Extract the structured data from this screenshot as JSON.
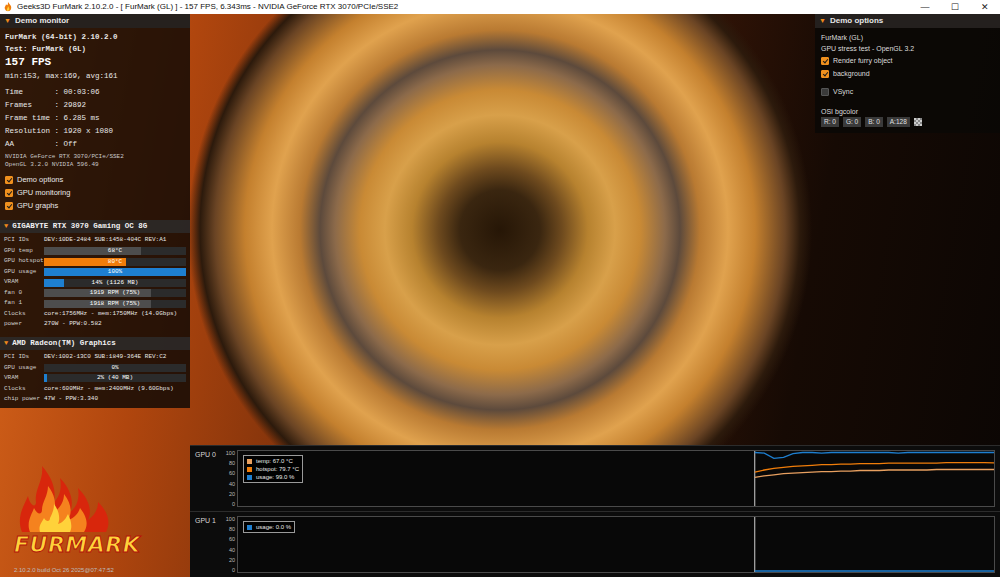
{
  "window": {
    "title": "Geeks3D FurMark 2.10.2.0 - [ FurMark (GL) ] - 157 FPS, 6.343ms - NVIDIA GeForce RTX 3070/PCIe/SSE2",
    "controls": [
      "—",
      "☐",
      "✕"
    ]
  },
  "monitor": {
    "arrow": "▼",
    "title": "Demo monitor",
    "app": "FurMark (64-bit) 2.10.2.0",
    "test": "Test: FurMark (GL)",
    "fps": "157 FPS",
    "fps_stats": "min:153, max:169, avg:161",
    "stats": [
      {
        "label": "Time",
        "value": ": 00:03:06"
      },
      {
        "label": "Frames",
        "value": ": 29892"
      },
      {
        "label": "Frame time",
        "value": ": 6.285 ms"
      },
      {
        "label": "Resolution",
        "value": ": 1920 x 1080"
      },
      {
        "label": "AA",
        "value": ": Off"
      }
    ],
    "renderer": "NVIDIA GeForce RTX 3070/PCIe/SSE2",
    "opengl": "OpenGL 3.2.0 NVIDIA 596.49",
    "toggles": [
      {
        "label": "Demo options",
        "checked": true
      },
      {
        "label": "GPU monitoring",
        "checked": true
      },
      {
        "label": "GPU graphs",
        "checked": true
      }
    ]
  },
  "gpus": [
    {
      "arrow": "▼",
      "name": "GIGABYTE RTX 3070 Gaming OC 8G",
      "rows": [
        {
          "kind": "text",
          "label": "PCI IDs",
          "value": "DEV:10DE-2484 SUB:1458-404C REV:A1"
        },
        {
          "kind": "bar",
          "label": "GPU temp",
          "value": "68°C",
          "level": 0.68,
          "color": "#4d4d4d"
        },
        {
          "kind": "bar",
          "label": "GPU hotspot",
          "value": "80°C",
          "level": 0.58,
          "color": "#f07d0a"
        },
        {
          "kind": "bar",
          "label": "GPU usage",
          "value": "100%",
          "level": 1.0,
          "color": "#1e7fd0"
        },
        {
          "kind": "bar",
          "label": "VRAM",
          "value": "14% (1126 MB)",
          "level": 0.14,
          "color": "#1e7fd0"
        },
        {
          "kind": "bar",
          "label": "fan 0",
          "value": "1919 RPM (75%)",
          "level": 0.75,
          "color": "#4d4d4d"
        },
        {
          "kind": "bar",
          "label": "fan 1",
          "value": "1918 RPM (75%)",
          "level": 0.75,
          "color": "#4d4d4d"
        },
        {
          "kind": "text",
          "label": "Clocks",
          "value": "core:1756MHz - mem:1750MHz (14.0Gbps)"
        },
        {
          "kind": "text",
          "label": "power",
          "value": "270W - PPW:0.582"
        }
      ]
    },
    {
      "arrow": "▼",
      "name": "AMD Radeon(TM) Graphics",
      "rows": [
        {
          "kind": "text",
          "label": "PCI IDs",
          "value": "DEV:1002-13C0 SUB:1849-364E REV:C2"
        },
        {
          "kind": "bar",
          "label": "GPU usage",
          "value": "0%",
          "level": 0.0,
          "color": "#1e7fd0"
        },
        {
          "kind": "bar",
          "label": "VRAM",
          "value": "2% (40 MB)",
          "level": 0.02,
          "color": "#1e7fd0"
        },
        {
          "kind": "text",
          "label": "Clocks",
          "value": "core:600MHz - mem:2400MHz (9.60Gbps)"
        },
        {
          "kind": "text",
          "label": "chip power",
          "value": "47W - PPW:3.340"
        }
      ]
    }
  ],
  "logo": {
    "text": "FURMARK",
    "build": "2.10.2.0 build Oct 26 2025@07:47:52"
  },
  "options": {
    "arrow": "▼",
    "title": "Demo options",
    "demo": "FurMark (GL)",
    "description": "GPU stress test - OpenGL 3.2",
    "checks": [
      {
        "label": "Render furry object",
        "checked": true
      },
      {
        "label": "background",
        "checked": true
      },
      {
        "label": "VSync",
        "checked": false
      }
    ],
    "bgcolor_label": "OSI bgcolor",
    "bgcolor_fields": [
      "R: 0",
      "G: 0",
      "B: 0",
      "A:128"
    ]
  },
  "graphs": [
    {
      "label": "GPU 0",
      "ticks": [
        "100",
        "80",
        "60",
        "40",
        "20",
        "0"
      ],
      "series": [
        {
          "name": "temp: 67.0 °C",
          "color": "#e8a060",
          "values": [
            52,
            55,
            57,
            59,
            60,
            61,
            62,
            63,
            63,
            64,
            64,
            65,
            65,
            65,
            66,
            66,
            66,
            66,
            66,
            67,
            67,
            67,
            67,
            67,
            67,
            67
          ]
        },
        {
          "name": "hotspot: 79.7 °C",
          "color": "#f07d0a",
          "values": [
            62,
            66,
            69,
            71,
            73,
            74,
            75,
            76,
            76,
            77,
            77,
            78,
            78,
            78,
            79,
            79,
            79,
            79,
            79,
            79,
            80,
            80,
            80,
            80,
            80,
            79.7
          ]
        },
        {
          "name": "usage: 99.0 %",
          "color": "#1e7fd0",
          "values": [
            99,
            98,
            88,
            90,
            97,
            99,
            99,
            98,
            99,
            99,
            99,
            99,
            99,
            99,
            99,
            98,
            99,
            99,
            99,
            99,
            99,
            99,
            99,
            99,
            99,
            99
          ]
        }
      ]
    },
    {
      "label": "GPU 1",
      "ticks": [
        "100",
        "80",
        "60",
        "40",
        "20",
        "0"
      ],
      "series": [
        {
          "name": "usage: 0.0 %",
          "color": "#1e7fd0",
          "values": [
            0,
            0,
            0,
            0,
            0,
            0,
            0,
            0,
            0,
            0,
            0,
            0,
            0,
            0,
            0,
            0,
            0,
            0,
            0,
            0,
            0,
            0,
            0,
            0,
            0,
            0
          ]
        }
      ]
    }
  ]
}
